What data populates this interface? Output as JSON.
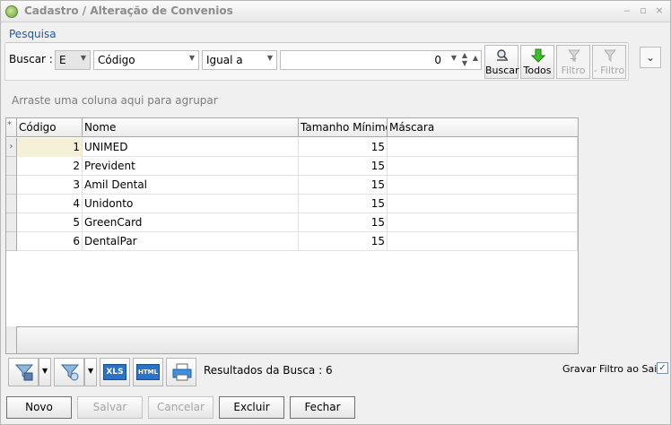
{
  "window": {
    "title": "Cadastro / Alteração de Convenios"
  },
  "search": {
    "section_label": "Pesquisa",
    "label": "Buscar :",
    "logic_value": "E",
    "field_value": "Código",
    "operator_value": "Igual a",
    "value": "0"
  },
  "toolbar": {
    "buscar_label": "Buscar",
    "todos_label": "Todos",
    "add_filter_label": "+ Filtro",
    "remove_filter_label": "- Filtro"
  },
  "grid": {
    "group_hint": "Arraste uma coluna aqui para agrupar",
    "columns": [
      "Código",
      "Nome",
      "Tamanho Mínimo",
      "Máscara"
    ],
    "rows": [
      {
        "codigo": "1",
        "nome": "UNIMED",
        "tamanho": "15",
        "mascara": ""
      },
      {
        "codigo": "2",
        "nome": "Prevident",
        "tamanho": "15",
        "mascara": ""
      },
      {
        "codigo": "3",
        "nome": "Amil Dental",
        "tamanho": "15",
        "mascara": ""
      },
      {
        "codigo": "4",
        "nome": "Unidonto",
        "tamanho": "15",
        "mascara": ""
      },
      {
        "codigo": "5",
        "nome": "GreenCard",
        "tamanho": "15",
        "mascara": ""
      },
      {
        "codigo": "6",
        "nome": "DentalPar",
        "tamanho": "15",
        "mascara": ""
      }
    ]
  },
  "status": {
    "results_label": "Resultados da Busca : 6",
    "save_filter_label": "Gravar Filtro ao Sair",
    "save_filter_checked": true
  },
  "actions": {
    "novo": "Novo",
    "salvar": "Salvar",
    "cancelar": "Cancelar",
    "excluir": "Excluir",
    "fechar": "Fechar"
  },
  "icons": {
    "xls": "XLS",
    "html": "HTML"
  },
  "colors": {
    "accent": "#2055a6",
    "selected_row": "#f5f1d8"
  }
}
